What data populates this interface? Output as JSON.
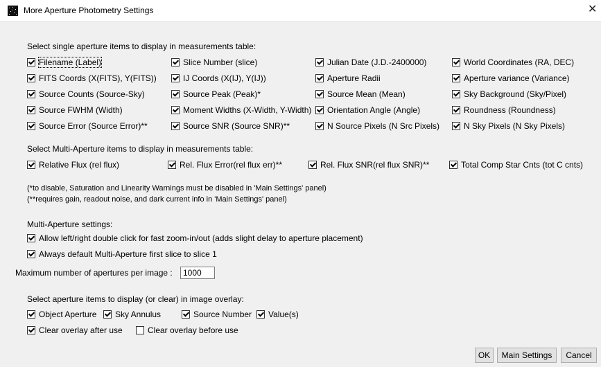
{
  "window": {
    "title": "More Aperture Photometry Settings",
    "close_glyph": "✕"
  },
  "single_section": {
    "heading": "Select single aperture items to display in measurements table:",
    "items": [
      {
        "label": "Filename (Label)",
        "checked": true
      },
      {
        "label": "Slice Number (slice)",
        "checked": true
      },
      {
        "label": "Julian Date (J.D.-2400000)",
        "checked": true
      },
      {
        "label": "World Coordinates (RA, DEC)",
        "checked": true
      },
      {
        "label": "FITS Coords (X(FITS), Y(FITS))",
        "checked": true
      },
      {
        "label": "IJ Coords (X(IJ), Y(IJ))",
        "checked": true
      },
      {
        "label": "Aperture Radii",
        "checked": true
      },
      {
        "label": "Aperture variance (Variance)",
        "checked": true
      },
      {
        "label": "Source Counts (Source-Sky)",
        "checked": true
      },
      {
        "label": "Source Peak (Peak)*",
        "checked": true
      },
      {
        "label": "Source Mean (Mean)",
        "checked": true
      },
      {
        "label": "Sky Background (Sky/Pixel)",
        "checked": true
      },
      {
        "label": "Source FWHM (Width)",
        "checked": true
      },
      {
        "label": "Moment Widths (X-Width, Y-Width)",
        "checked": true
      },
      {
        "label": "Orientation Angle (Angle)",
        "checked": true
      },
      {
        "label": "Roundness (Roundness)",
        "checked": true
      },
      {
        "label": "Source Error (Source Error)**",
        "checked": true
      },
      {
        "label": "Source SNR (Source SNR)**",
        "checked": true
      },
      {
        "label": "N Source Pixels (N Src Pixels)",
        "checked": true
      },
      {
        "label": "N Sky Pixels (N Sky Pixels)",
        "checked": true
      }
    ]
  },
  "multi_section": {
    "heading": "Select Multi-Aperture items to display in measurements table:",
    "items": [
      {
        "label": "Relative Flux (rel flux)",
        "checked": true
      },
      {
        "label": "Rel. Flux Error(rel flux err)**",
        "checked": true
      },
      {
        "label": "Rel. Flux SNR(rel flux SNR)**",
        "checked": true
      },
      {
        "label": "Total Comp Star Cnts (tot C cnts)",
        "checked": true
      }
    ]
  },
  "notes": [
    "(*to disable, Saturation and Linearity Warnings must be disabled in 'Main Settings' panel)",
    "(**requires gain, readout noise, and dark current info in 'Main Settings' panel)"
  ],
  "multi_settings": {
    "heading": "Multi-Aperture settings:",
    "items": [
      {
        "label": "Allow left/right double click for fast zoom-in/out (adds slight delay to aperture placement)",
        "checked": true
      },
      {
        "label": "Always default Multi-Aperture first slice to slice 1",
        "checked": true
      }
    ]
  },
  "max_apertures": {
    "label": "Maximum number of apertures per image :",
    "value": "1000"
  },
  "overlay_section": {
    "heading": "Select aperture items to display (or clear) in image overlay:",
    "items": [
      {
        "label": "Object Aperture",
        "checked": true
      },
      {
        "label": "Sky Annulus",
        "checked": true
      },
      {
        "label": "Source Number",
        "checked": true
      },
      {
        "label": "Value(s)",
        "checked": true
      },
      {
        "label": "Clear overlay after use",
        "checked": true
      },
      {
        "label": "Clear overlay before use",
        "checked": false
      }
    ]
  },
  "buttons": {
    "ok": "OK",
    "main_settings": "Main Settings",
    "cancel": "Cancel"
  }
}
